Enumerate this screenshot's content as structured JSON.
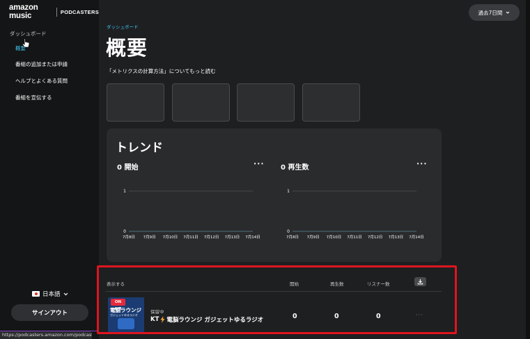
{
  "brand": {
    "logo": "amazon music",
    "product": "PODCASTERS"
  },
  "sidebar": {
    "section_title": "ダッシュボード",
    "items": [
      {
        "label": "概要",
        "active": true
      },
      {
        "label": "番組の追加または申請",
        "active": false
      },
      {
        "label": "ヘルプとよくある質問",
        "active": false
      },
      {
        "label": "番組を宣伝する",
        "active": false
      }
    ],
    "language": "日本語",
    "signin_label": "サインアウト"
  },
  "status_bar_url": "https://podcasters.amazon.com/podcasts",
  "header": {
    "period_label": "過去7日間"
  },
  "main": {
    "breadcrumb": "ダッシュボード",
    "title": "概要",
    "metrics_link": "「メトリクスの計算方法」についてもっと読む"
  },
  "trend": {
    "title": "トレンド",
    "more_label": "···",
    "metrics": [
      {
        "label": "0 開始"
      },
      {
        "label": "0 再生数"
      }
    ]
  },
  "chart_data": [
    {
      "type": "line",
      "categories": [
        "7月8日",
        "7月9日",
        "7月10日",
        "7月11日",
        "7月12日",
        "7月13日",
        "7月14日"
      ],
      "y_tick_labels": [
        "1",
        "0"
      ],
      "series": [
        {
          "values": [
            0,
            0,
            0,
            0,
            0,
            0,
            0
          ]
        }
      ],
      "ylim": [
        0,
        1
      ],
      "grid": true
    },
    {
      "type": "line",
      "categories": [
        "7月8日",
        "7月9日",
        "7月10日",
        "7月11日",
        "7月12日",
        "7月13日",
        "7月14日"
      ],
      "y_tick_labels": [
        "1",
        "0"
      ],
      "series": [
        {
          "values": [
            0,
            0,
            0,
            0,
            0,
            0,
            0
          ]
        }
      ],
      "ylim": [
        0,
        1
      ],
      "grid": true
    }
  ],
  "table": {
    "headers": {
      "show": "表示する",
      "starts": "開始",
      "plays": "再生数",
      "listeners": "リスナー数"
    },
    "rows": [
      {
        "status": "保留中",
        "title_prefix": "KT",
        "title": "電脳ラウンジ ガジェットゆるラジオ",
        "thumb_badge": "ON AIR",
        "thumb_title": "電脳ラウンジ",
        "thumb_sub": "ガジェットゆるラジオ",
        "starts": "0",
        "plays": "0",
        "listeners": "0",
        "more": "···"
      }
    ]
  },
  "colors": {
    "accent": "#3dc5f0",
    "highlight_frame": "#e0141e",
    "background": "#1e1f21",
    "sidebar": "#141516"
  },
  "icons": {
    "cursor": "hand-pointer-icon",
    "download": "download-icon",
    "lightning": "lightning-icon",
    "chevron": "chevron-down-icon"
  }
}
